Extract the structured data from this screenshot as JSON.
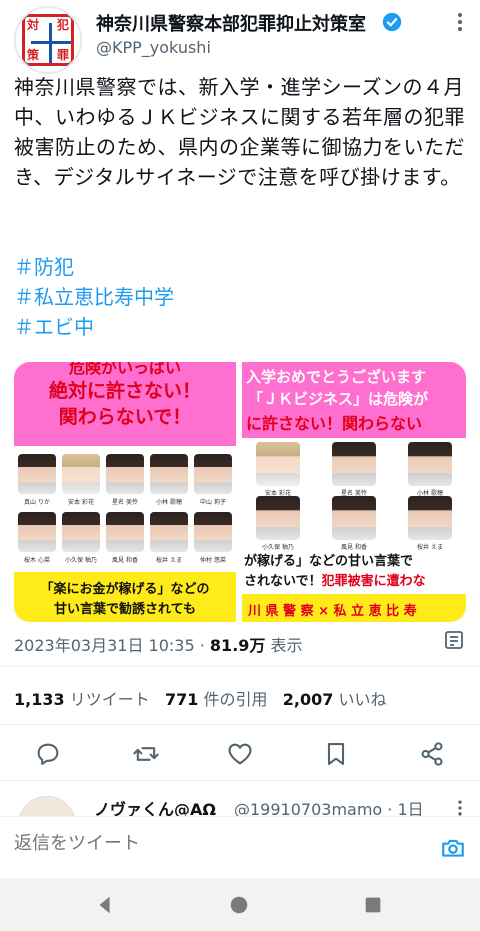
{
  "account": {
    "display_name": "神奈川県警察本部犯罪抑止対策室",
    "handle": "@KPP_yokushi",
    "avatar_chars": [
      "対",
      "犯",
      "策",
      "罪"
    ]
  },
  "tweet": {
    "text": "神奈川県警察では、新入学・進学シーズンの４月中、いわゆるＪＫビジネスに関する若年層の犯罪被害防止のため、県内の企業等に御協力をいただき、デジタルサイネージで注意を呼び掛けます。",
    "hashtags": [
      "＃防犯",
      "＃私立恵比寿中学",
      "＃エビ中"
    ],
    "timestamp": "2023年03月31日 10:35",
    "views_count": "81.9万",
    "views_label": "表示"
  },
  "media": {
    "left": {
      "top_banner_partial": "危険がいっぱい",
      "banner_line1": "絶対に許さない！",
      "banner_line2": "関わらないで！",
      "names_row1": [
        "真山 りか",
        "安本 彩花",
        "星名 美怜",
        "小林 歌穂",
        "中山 莉子"
      ],
      "names_row2": [
        "桜木 心菜",
        "小久保 柚乃",
        "風見 和香",
        "桜井 えま",
        "仲村 悠菜"
      ],
      "bottom_line1": "「楽にお金が稼げる」などの",
      "bottom_line2": "甘い言葉で勧誘されても"
    },
    "right": {
      "banner_line1": "入学おめでとうございます",
      "banner_line2": "「ＪＫビジネス」は危険が",
      "banner_line3": "に許さない！関わらない",
      "names_row1": [
        "安本 彩花",
        "星名 美怜",
        "小林 歌穂"
      ],
      "names_row2": [
        "小久保 柚乃",
        "風見 和香",
        "桜井 えま"
      ],
      "bottom_line1": "が稼げる」などの甘い言葉で",
      "bottom_line2a": "されないで！",
      "bottom_line2b": "犯罪被害に遭わな",
      "footer": "川 県 警 察 × 私 立 恵 比 寿"
    }
  },
  "stats": {
    "retweets_count": "1,133",
    "retweets_label": "リツイート",
    "quotes_count": "771",
    "quotes_label": "件の引用",
    "likes_count": "2,007",
    "likes_label": "いいね"
  },
  "reply_preview": {
    "name": "ノヴァくん@AΩ",
    "handle": "@19910703mamo · 1日"
  },
  "compose": {
    "placeholder": "返信をツイート"
  },
  "colors": {
    "verified": "#1d9bf0",
    "hashtag": "#1d9bf0",
    "banner_pink": "#ff6fd0",
    "banner_yellow": "#ffeb1a",
    "banner_red": "#e0001a"
  }
}
